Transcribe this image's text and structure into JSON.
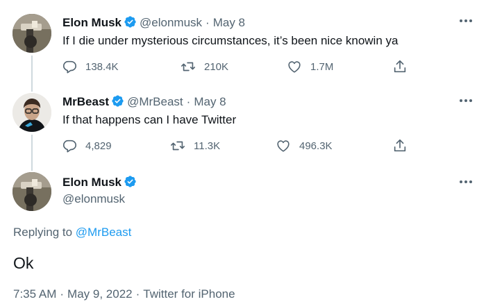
{
  "tweets": [
    {
      "display_name": "Elon Musk",
      "handle": "@elonmusk",
      "separator": "·",
      "date": "May 8",
      "text": "If I die under mysterious circumstances, it’s been nice knowin ya",
      "replies": "138.4K",
      "retweets": "210K",
      "likes": "1.7M"
    },
    {
      "display_name": "MrBeast",
      "handle": "@MrBeast",
      "separator": "·",
      "date": "May 8",
      "text": "If that happens can I have Twitter",
      "replies": "4,829",
      "retweets": "11.3K",
      "likes": "496.3K"
    }
  ],
  "main_tweet": {
    "display_name": "Elon Musk",
    "handle": "@elonmusk",
    "replying_prefix": "Replying to",
    "replying_to": "@MrBeast",
    "text": "Ok",
    "time": "7:35 AM",
    "date": "May 9, 2022",
    "source": "Twitter for iPhone",
    "separator": "·"
  },
  "icons": {
    "verified": "verified-badge-icon",
    "more": "more-options-icon",
    "reply": "reply-icon",
    "retweet": "retweet-icon",
    "like": "heart-icon",
    "share": "share-icon"
  },
  "colors": {
    "verified": "#1d9bf0",
    "link": "#1d9bf0",
    "muted": "#536471",
    "thread_line": "#cfd9de"
  }
}
